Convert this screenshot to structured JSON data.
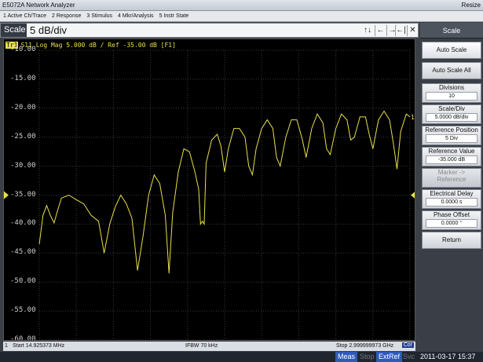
{
  "window": {
    "title": "E5072A Network Analyzer",
    "resize_label": "Resize"
  },
  "menu": [
    "1 Active Ch/Trace",
    "2 Response",
    "3 Stimulus",
    "4 Mkr/Analysis",
    "5 Instr State"
  ],
  "entry": {
    "label": "Scale",
    "value": "5 dB/div",
    "controls": [
      "↑↓",
      "←",
      "→",
      "←|",
      "✕"
    ]
  },
  "trace": {
    "badge": "Tr1",
    "header": "S11 Log Mag 5.000 dB / Ref -35.00 dB [F1]",
    "channel_marker": "1",
    "color": "#e8e04a"
  },
  "status": {
    "channel": "1",
    "start": "Start 14.925373 MHz",
    "ifbw": "IFBW 70 kHz",
    "stop": "Stop 2.999999973 GHz",
    "cor": "Cor"
  },
  "bottom": {
    "meas": "Meas",
    "stop": "Stop",
    "extref": "ExtRef",
    "svc": "Svc",
    "datetime": "2011-03-17 15:37"
  },
  "softkeys": {
    "title": "Scale",
    "auto_scale": "Auto Scale",
    "auto_scale_all": "Auto Scale All",
    "divisions": {
      "label": "Divisions",
      "value": "10"
    },
    "scale_div": {
      "label": "Scale/Div",
      "value": "5.0000 dB/div"
    },
    "ref_position": {
      "label": "Reference Position",
      "value": "5 Div"
    },
    "ref_value": {
      "label": "Reference Value",
      "value": "-35.000 dB"
    },
    "marker_ref": {
      "label": "Marker ->",
      "label2": "Reference"
    },
    "elec_delay": {
      "label": "Electrical Delay",
      "value": "0.0000 s"
    },
    "phase_offset": {
      "label": "Phase Offset",
      "value": "0.0000 °"
    },
    "return": "Return"
  },
  "chart_data": {
    "type": "line",
    "title": "",
    "xlabel": "",
    "ylabel": "",
    "x_range": [
      "14.925373 MHz",
      "2.999999973 GHz"
    ],
    "ylim": [
      -60,
      -10
    ],
    "yticks": [
      "-10.00",
      "-15.00",
      "-20.00",
      "-25.00",
      "-30.00",
      "-35.00",
      "-40.00",
      "-45.00",
      "-50.00",
      "-55.00",
      "-60.00"
    ],
    "reference": -35,
    "grid": true,
    "series": [
      {
        "color": "#e8e04a",
        "points": [
          [
            0,
            -43.5
          ],
          [
            0.01,
            -38.5
          ],
          [
            0.02,
            -36.8
          ],
          [
            0.03,
            -38.5
          ],
          [
            0.04,
            -39.8
          ],
          [
            0.05,
            -37.5
          ],
          [
            0.06,
            -35.5
          ],
          [
            0.08,
            -35.0
          ],
          [
            0.1,
            -35.8
          ],
          [
            0.12,
            -36.5
          ],
          [
            0.14,
            -38.5
          ],
          [
            0.16,
            -39.5
          ],
          [
            0.175,
            -45.0
          ],
          [
            0.19,
            -40.0
          ],
          [
            0.205,
            -37.0
          ],
          [
            0.22,
            -35.0
          ],
          [
            0.235,
            -36.5
          ],
          [
            0.25,
            -39.0
          ],
          [
            0.265,
            -48.0
          ],
          [
            0.28,
            -42.0
          ],
          [
            0.295,
            -35.0
          ],
          [
            0.31,
            -31.5
          ],
          [
            0.325,
            -33.0
          ],
          [
            0.34,
            -38.5
          ],
          [
            0.35,
            -48.5
          ],
          [
            0.36,
            -38.0
          ],
          [
            0.375,
            -31.0
          ],
          [
            0.39,
            -27.0
          ],
          [
            0.405,
            -27.5
          ],
          [
            0.42,
            -31.0
          ],
          [
            0.43,
            -34.0
          ],
          [
            0.435,
            -40.0
          ],
          [
            0.44,
            -39.5
          ],
          [
            0.445,
            -40.0
          ],
          [
            0.45,
            -29.5
          ],
          [
            0.465,
            -25.5
          ],
          [
            0.48,
            -24.5
          ],
          [
            0.49,
            -26.5
          ],
          [
            0.5,
            -31.0
          ],
          [
            0.51,
            -27.0
          ],
          [
            0.525,
            -23.5
          ],
          [
            0.54,
            -23.5
          ],
          [
            0.555,
            -25.0
          ],
          [
            0.565,
            -30.0
          ],
          [
            0.575,
            -31.5
          ],
          [
            0.585,
            -27.0
          ],
          [
            0.6,
            -23.5
          ],
          [
            0.615,
            -22.0
          ],
          [
            0.63,
            -23.5
          ],
          [
            0.64,
            -28.5
          ],
          [
            0.65,
            -30.0
          ],
          [
            0.665,
            -25.0
          ],
          [
            0.68,
            -22.0
          ],
          [
            0.695,
            -22.0
          ],
          [
            0.71,
            -25.5
          ],
          [
            0.72,
            -28.5
          ],
          [
            0.735,
            -23.5
          ],
          [
            0.75,
            -21.0
          ],
          [
            0.765,
            -22.5
          ],
          [
            0.775,
            -27.0
          ],
          [
            0.785,
            -28.0
          ],
          [
            0.8,
            -23.5
          ],
          [
            0.815,
            -21.0
          ],
          [
            0.83,
            -22.0
          ],
          [
            0.84,
            -25.5
          ],
          [
            0.85,
            -25.0
          ],
          [
            0.865,
            -21.5
          ],
          [
            0.88,
            -21.5
          ],
          [
            0.89,
            -24.5
          ],
          [
            0.9,
            -27.0
          ],
          [
            0.915,
            -22.0
          ],
          [
            0.93,
            -20.5
          ],
          [
            0.945,
            -22.0
          ],
          [
            0.955,
            -26.0
          ],
          [
            0.965,
            -30.5
          ],
          [
            0.975,
            -24.0
          ],
          [
            0.99,
            -21.0
          ],
          [
            1.0,
            -21.5
          ]
        ]
      }
    ]
  }
}
